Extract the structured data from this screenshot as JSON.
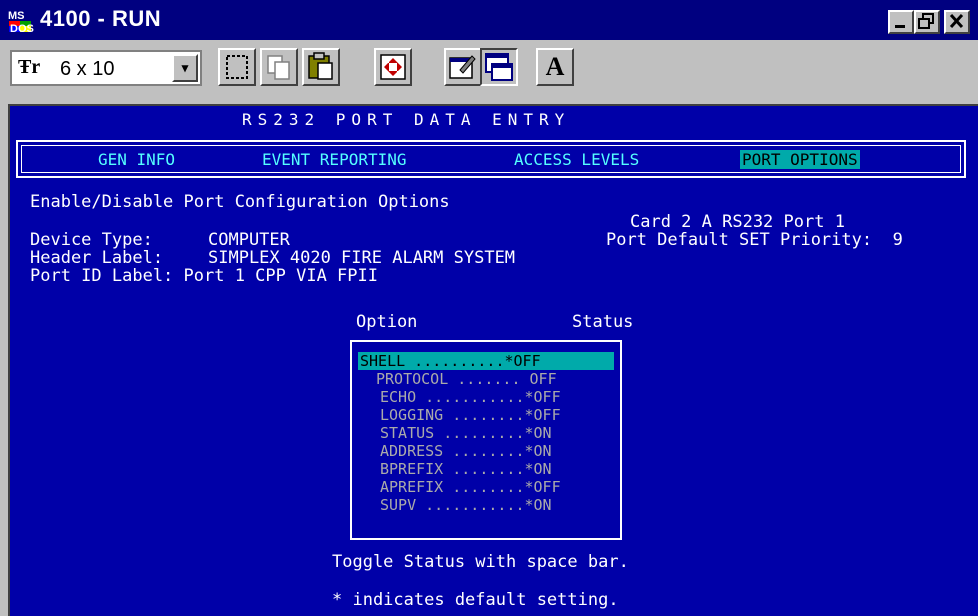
{
  "window": {
    "title": "4100 - RUN",
    "icon": "ms-dos-icon",
    "controls": [
      "minimize",
      "restore",
      "close"
    ]
  },
  "toolbar": {
    "font_value": "6 x 10",
    "font_icon": "Ŧr",
    "tools": [
      "mark-icon",
      "copy-icon",
      "paste-icon",
      "fullscreen-icon",
      "properties-icon",
      "background-icon",
      "font-icon"
    ],
    "font_glyph": "A"
  },
  "screen": {
    "header": "RS232 PORT DATA ENTRY",
    "menu": [
      "GEN INFO",
      "EVENT REPORTING",
      "ACCESS LEVELS",
      "PORT OPTIONS"
    ],
    "selected_menu": "PORT OPTIONS",
    "subtitle": "Enable/Disable Port Configuration Options",
    "card": "Card 2 A RS232 Port 1",
    "priority": "Port Default SET Priority:  9",
    "device_type_label": "Device Type:",
    "device_type": "COMPUTER",
    "header_label_label": "Header Label:",
    "header_label": "SIMPLEX 4020 FIRE ALARM SYSTEM",
    "port_id_label": "Port ID Label: Port 1 CPP VIA FPII",
    "col_option": "Option",
    "col_status": "Status",
    "options": [
      "SHELL ..........*OFF",
      "PROTOCOL ....... OFF",
      "ECHO ...........*OFF",
      "LOGGING ........*OFF",
      "STATUS .........*ON",
      "ADDRESS ........*ON",
      "BPREFIX ........*ON",
      "APREFIX ........*OFF",
      "SUPV ...........*ON"
    ],
    "hint": "Toggle Status with space bar.",
    "footnote": "* indicates default setting."
  }
}
